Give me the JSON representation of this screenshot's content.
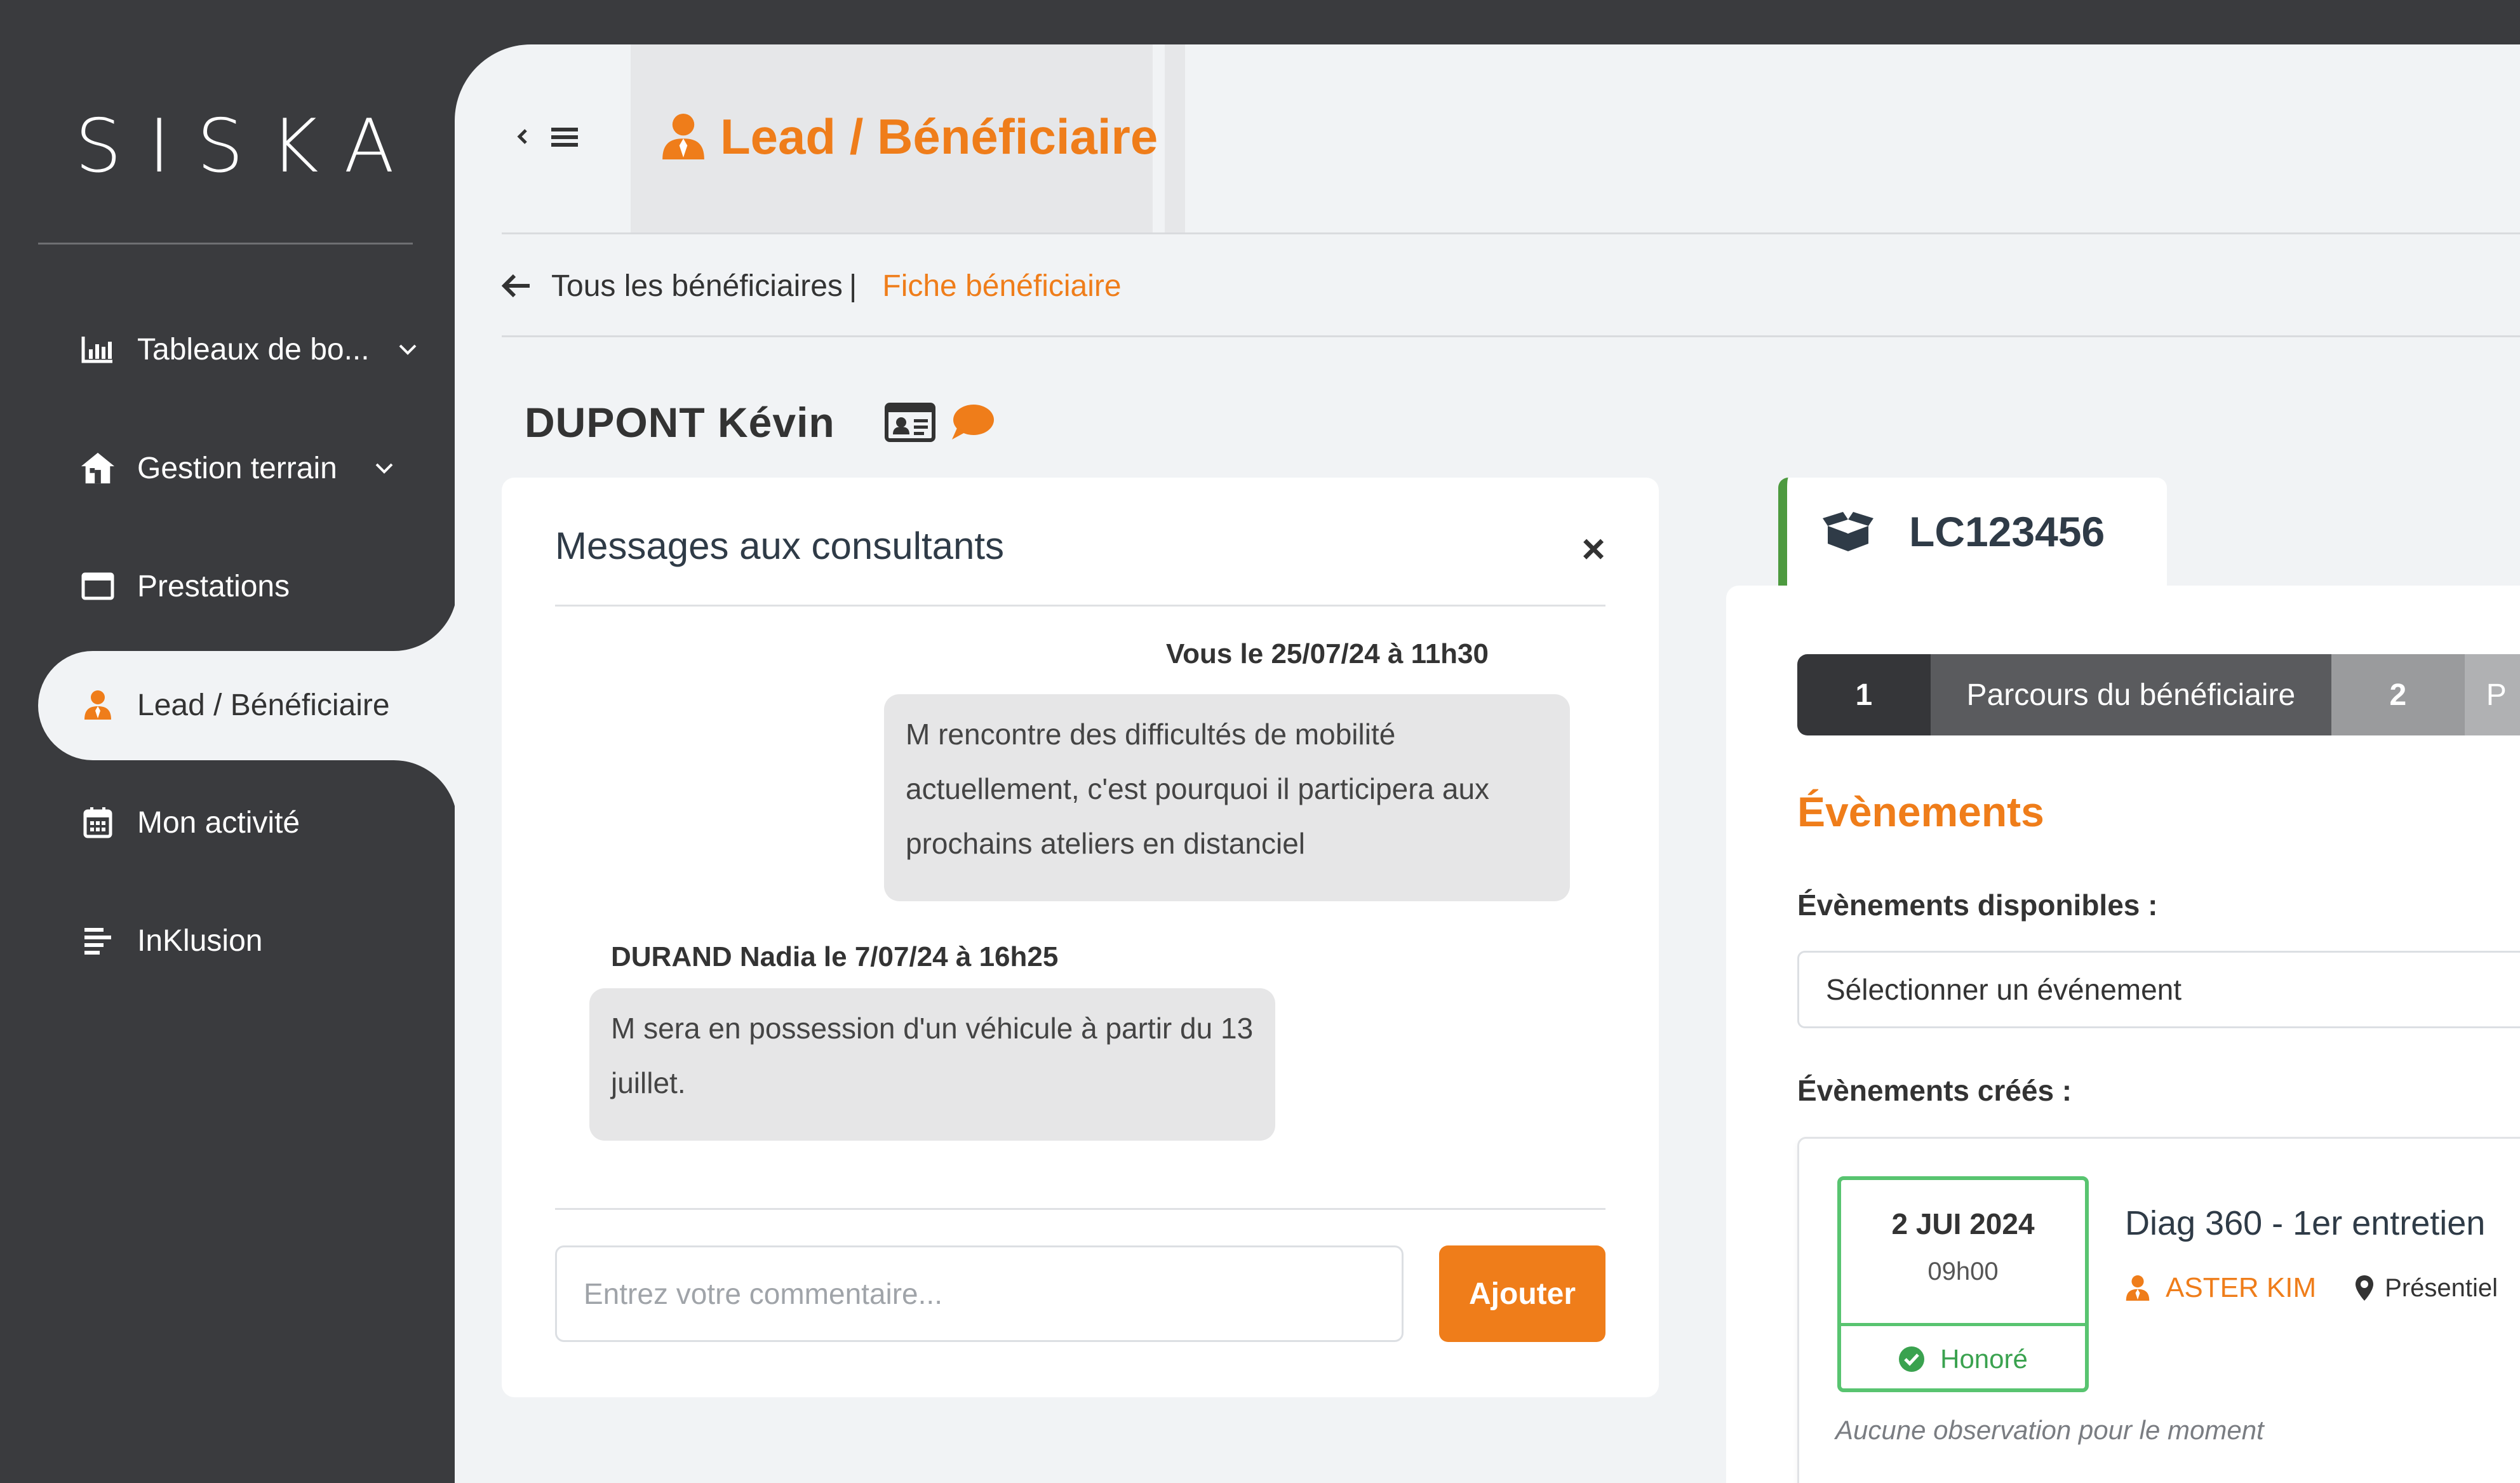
{
  "brand": {
    "name": "SISKA"
  },
  "colors": {
    "accent": "#ef7d1a",
    "sidebar": "#3a3b3e",
    "success": "#58c470",
    "background": "#f1f3f5"
  },
  "sidebar": {
    "items": [
      {
        "label": "Tableaux de bo...",
        "icon": "chart-bar-icon",
        "has_chevron": true
      },
      {
        "label": "Gestion terrain",
        "icon": "house-icon",
        "has_chevron": true
      },
      {
        "label": "Prestations",
        "icon": "window-icon",
        "has_chevron": false
      },
      {
        "label": "Lead / Bénéficiaire",
        "icon": "user-icon",
        "has_chevron": false,
        "active": true
      },
      {
        "label": "Mon activité",
        "icon": "calendar-icon",
        "has_chevron": false
      },
      {
        "label": "InKlusion",
        "icon": "list-icon",
        "has_chevron": false
      }
    ]
  },
  "header": {
    "title": "Lead / Bénéficiaire"
  },
  "breadcrumb": {
    "back_label": "Tous les bénéficiaires",
    "separator": "|",
    "current": "Fiche bénéficiaire"
  },
  "person": {
    "name": "DUPONT Kévin"
  },
  "messages": {
    "title": "Messages aux consultants",
    "close": "×",
    "items": [
      {
        "meta": "Vous le 25/07/24 à 11h30",
        "text": "M rencontre des difficultés de mobilité actuellement, c'est pourquoi il participera aux prochains ateliers en distanciel"
      },
      {
        "meta": "DURAND Nadia le 7/07/24 à 16h25",
        "text": "M sera en possession d'un véhicule à partir du 13 juillet."
      }
    ],
    "input_placeholder": "Entrez votre commentaire...",
    "submit_label": "Ajouter"
  },
  "file": {
    "code": "LC123456",
    "steps": [
      {
        "number": "1",
        "label": "Parcours du bénéficiaire",
        "active": true
      },
      {
        "number": "2",
        "label": "P",
        "active": false
      }
    ],
    "events_title": "Évènements",
    "available_label": "Évènements disponibles :",
    "select_placeholder": "Sélectionner un événement",
    "created_label": "Évènements créés :",
    "event": {
      "date": "2 JUI 2024",
      "time": "09h00",
      "status": "Honoré",
      "title": "Diag 360 - 1er entretien",
      "consultant": "ASTER KIM",
      "mode": "Présentiel",
      "note": "Aucune observation pour le moment"
    }
  }
}
